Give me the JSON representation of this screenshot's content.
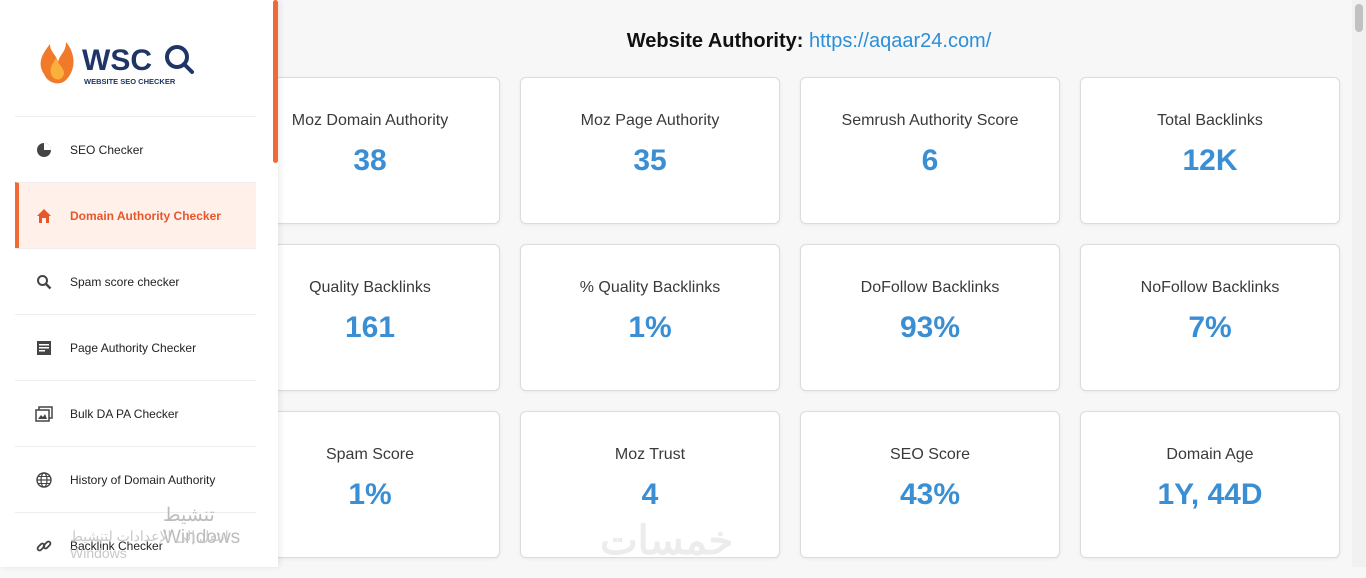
{
  "page": {
    "title_label": "Website Authority:",
    "title_url": "https://aqaar24.com/"
  },
  "logo": {
    "name": "WSC",
    "tagline": "WEBSITE SEO CHECKER"
  },
  "sidebar": {
    "items": [
      {
        "label": "SEO Checker",
        "icon": "pie-chart-icon"
      },
      {
        "label": "Domain Authority Checker",
        "icon": "home-icon",
        "active": true
      },
      {
        "label": "Spam score checker",
        "icon": "search-icon"
      },
      {
        "label": "Page Authority Checker",
        "icon": "document-icon"
      },
      {
        "label": "Bulk DA PA Checker",
        "icon": "images-icon"
      },
      {
        "label": "History of Domain Authority",
        "icon": "globe-icon"
      },
      {
        "label": "Backlink Checker",
        "icon": "link-icon"
      }
    ]
  },
  "metrics": [
    {
      "label": "Moz Domain Authority",
      "value": "38"
    },
    {
      "label": "Moz Page Authority",
      "value": "35"
    },
    {
      "label": "Semrush Authority Score",
      "value": "6"
    },
    {
      "label": "Total Backlinks",
      "value": "12K"
    },
    {
      "label": "Quality Backlinks",
      "value": "161"
    },
    {
      "label": "% Quality Backlinks",
      "value": "1%"
    },
    {
      "label": "DoFollow Backlinks",
      "value": "93%"
    },
    {
      "label": "NoFollow Backlinks",
      "value": "7%"
    },
    {
      "label": "Spam Score",
      "value": "1%"
    },
    {
      "label": "Moz Trust",
      "value": "4"
    },
    {
      "label": "SEO Score",
      "value": "43%"
    },
    {
      "label": "Domain Age",
      "value": "1Y, 44D"
    }
  ],
  "watermark": {
    "line1": "تنشيط Windows",
    "line2": "انتقل إلى الإعدادات لتنشيط Windows",
    "brand": "خمسات"
  }
}
